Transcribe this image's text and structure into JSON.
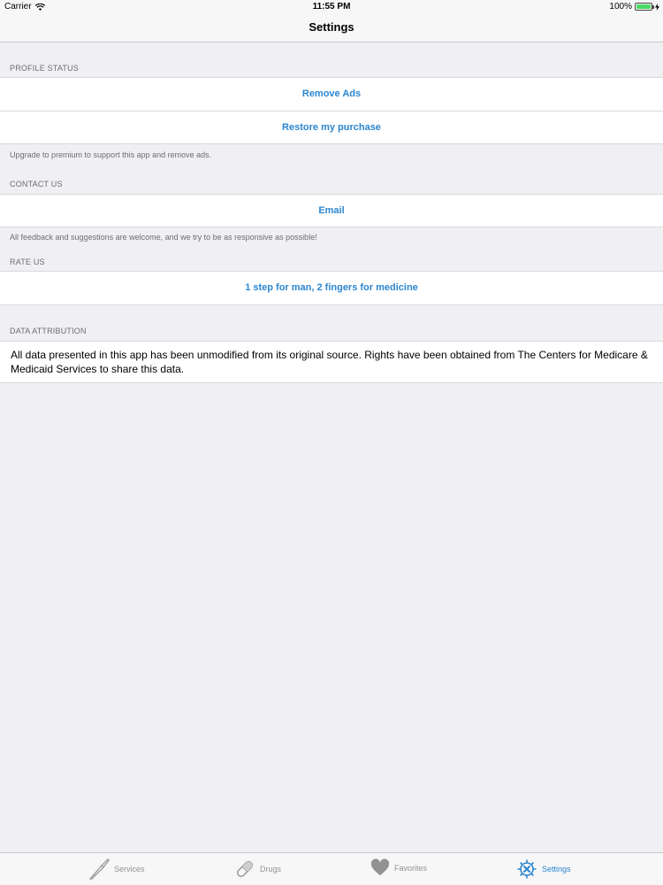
{
  "status_bar": {
    "carrier": "Carrier",
    "time": "11:55 PM",
    "battery": "100%"
  },
  "nav": {
    "title": "Settings"
  },
  "sections": {
    "profile": {
      "header": "PROFILE STATUS",
      "remove_ads": "Remove Ads",
      "restore": "Restore my purchase",
      "footer": "Upgrade to premium to support this app and remove ads."
    },
    "contact": {
      "header": "CONTACT US",
      "email": "Email",
      "footer": "All feedback and suggestions are welcome, and we try to be as responsive as possible!"
    },
    "rate": {
      "header": "RATE US",
      "rate_label": "1 step for man, 2 fingers for medicine"
    },
    "attribution": {
      "header": "DATA ATTRIBUTION",
      "text": "All data presented in this app has been unmodified from its original source. Rights have been obtained from The Centers for Medicare & Medicaid Services to share this data."
    }
  },
  "tabs": [
    {
      "label": "Services",
      "icon": "scalpel-icon",
      "active": false
    },
    {
      "label": "Drugs",
      "icon": "pill-icon",
      "active": false
    },
    {
      "label": "Favorites",
      "icon": "heart-icon",
      "active": false
    },
    {
      "label": "Settings",
      "icon": "settings-icon",
      "active": true
    }
  ],
  "colors": {
    "accent": "#2b86cf",
    "background": "#efeff4",
    "inactive_tab": "#929292"
  }
}
